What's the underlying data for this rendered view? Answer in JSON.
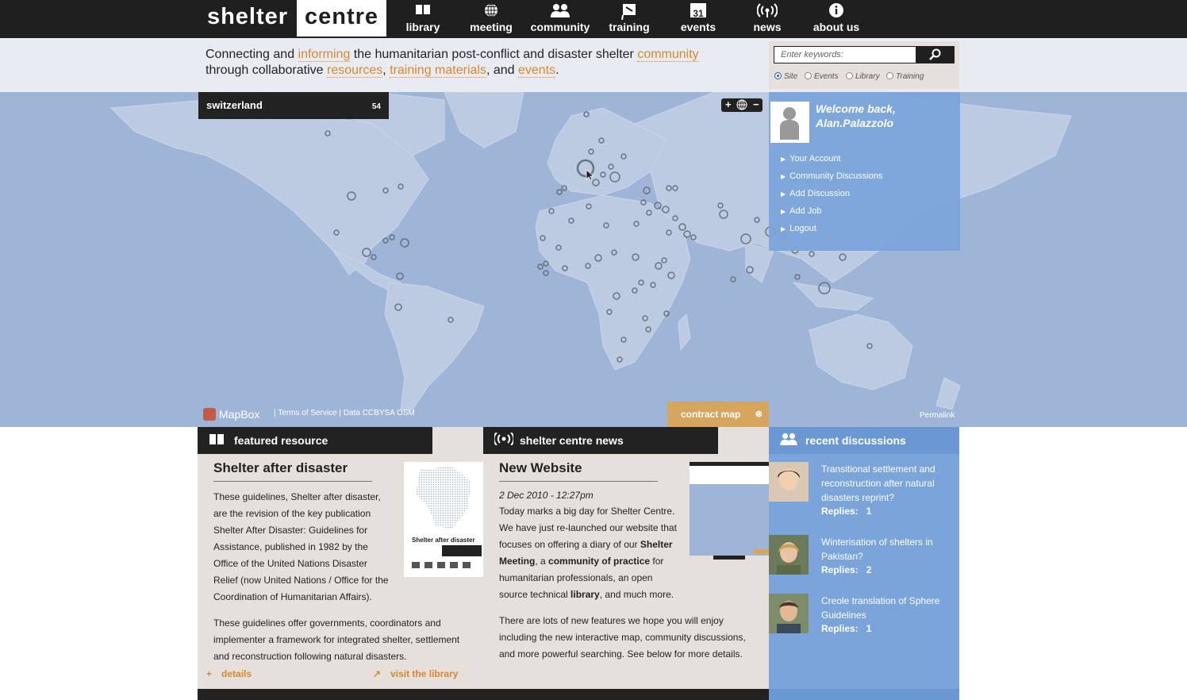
{
  "logo": {
    "part1": "shelter",
    "part2": "centre"
  },
  "nav": [
    {
      "label": "library",
      "icon": "book-icon"
    },
    {
      "label": "meeting",
      "icon": "globe-icon"
    },
    {
      "label": "community",
      "icon": "people-icon"
    },
    {
      "label": "training",
      "icon": "flag-icon"
    },
    {
      "label": "events",
      "icon": "calendar-icon",
      "icon_text": "31"
    },
    {
      "label": "news",
      "icon": "broadcast-icon"
    },
    {
      "label": "about us",
      "icon": "info-icon"
    }
  ],
  "tagline": {
    "t1": "Connecting and ",
    "l1": "informing",
    "t2": " the humanitarian post-conflict and disaster shelter ",
    "l2": "community",
    "t3": "through collaborative ",
    "l3": "resources",
    "t4": ", ",
    "l4": "training materials",
    "t5": ", and ",
    "l5": "events",
    "t6": "."
  },
  "search": {
    "placeholder": "Enter keywords:",
    "options": [
      "Site",
      "Events",
      "Library",
      "Training"
    ],
    "selected": "Site"
  },
  "map": {
    "region": "switzerland",
    "count": "54",
    "mapbox": "MapBox",
    "credits": "| Terms of Service | Data CCBYSA OSM",
    "contract": "contract map",
    "permalink": "Permalink"
  },
  "welcome": {
    "greeting": "Welcome back,",
    "user": "Alan.Palazzolo",
    "links": [
      "Your Account",
      "Community Discussions",
      "Add Discussion",
      "Add Job",
      "Logout"
    ]
  },
  "featured": {
    "heading": "featured resource",
    "title": "Shelter after disaster",
    "p1": "These guidelines, Shelter after disaster, are the revision of the key publication Shelter After Disaster: Guidelines for Assistance, published in 1982 by the Office of the United Nations Disaster Relief (now United Nations / Office for the Coordination of Humanitarian Affairs).",
    "p2": "These guidelines offer governments, coordinators and implementer a framework for integrated shelter, settlement and reconstruction following natural disasters.",
    "details": "details",
    "visit": "visit the library",
    "cover_title": "Shelter after disaster"
  },
  "news": {
    "heading": "shelter centre news",
    "title": "New Website",
    "date": "2 Dec 2010 - 12:27pm",
    "p1a": "Today marks a big day for Shelter Centre. We have just re-launched our website that focuses on offering a diary of our ",
    "b1": "Shelter Meeting",
    "p1b": ", a ",
    "b2": "community of practice",
    "p1c": " for humanitarian professionals, an open source technical ",
    "b3": "library",
    "p1d": ", and much more.",
    "p2": "There are lots of new features we hope you will enjoy including the new interactive map, community discussions, and more powerful searching.  See below for more details."
  },
  "recent": {
    "heading": "recent discussions",
    "items": [
      {
        "title": "Transitional settlement and reconstruction after natural disasters reprint?",
        "replies_label": "Replies:",
        "replies": "1"
      },
      {
        "title": "Winterisation of shelters in Pakistan?",
        "replies_label": "Replies:",
        "replies": "2"
      },
      {
        "title": "Creole translation of Sphere Guidelines",
        "replies_label": "Replies:",
        "replies": "1"
      }
    ]
  },
  "colors": {
    "accent": "#d9872b",
    "dark": "#1f1f1f",
    "blue": "#7aa4da",
    "map": "#9fb5d7"
  }
}
